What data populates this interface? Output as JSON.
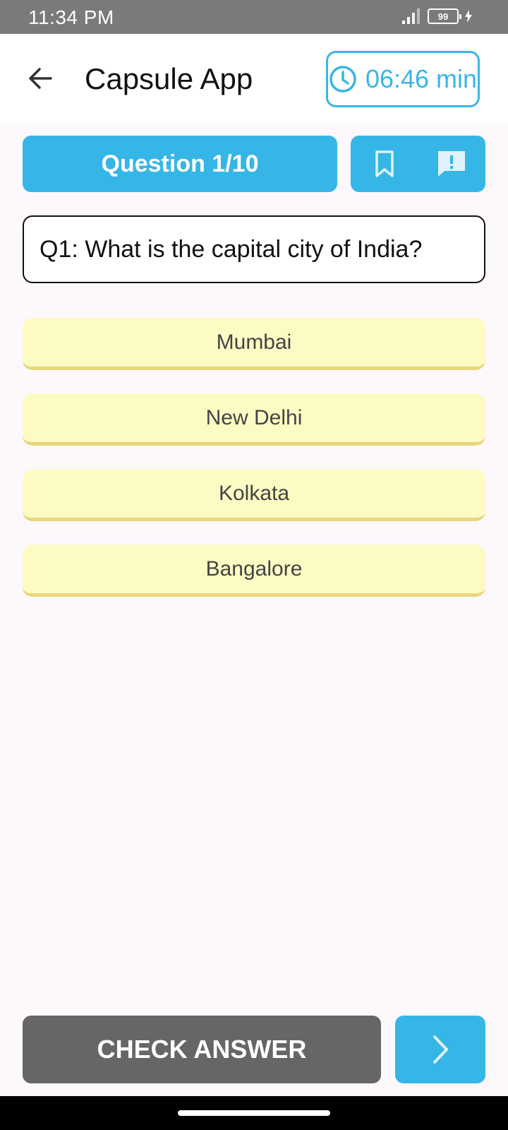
{
  "status_bar": {
    "time": "11:34 PM",
    "battery": "99"
  },
  "app_bar": {
    "title": "Capsule App",
    "timer": "06:46 min"
  },
  "question_header": {
    "label": "Question 1/10"
  },
  "question": {
    "text": "Q1: What is the capital city of India?"
  },
  "options": [
    {
      "label": "Mumbai"
    },
    {
      "label": "New Delhi"
    },
    {
      "label": "Kolkata"
    },
    {
      "label": "Bangalore"
    }
  ],
  "footer": {
    "check_label": "CHECK ANSWER"
  },
  "icons": {
    "back": "arrow-left-icon",
    "clock": "clock-icon",
    "bookmark": "bookmark-icon",
    "report": "report-icon",
    "next": "chevron-right-icon"
  },
  "colors": {
    "accent": "#36b6e6",
    "option_bg": "#fdfbc4",
    "check_bg": "#666666"
  }
}
